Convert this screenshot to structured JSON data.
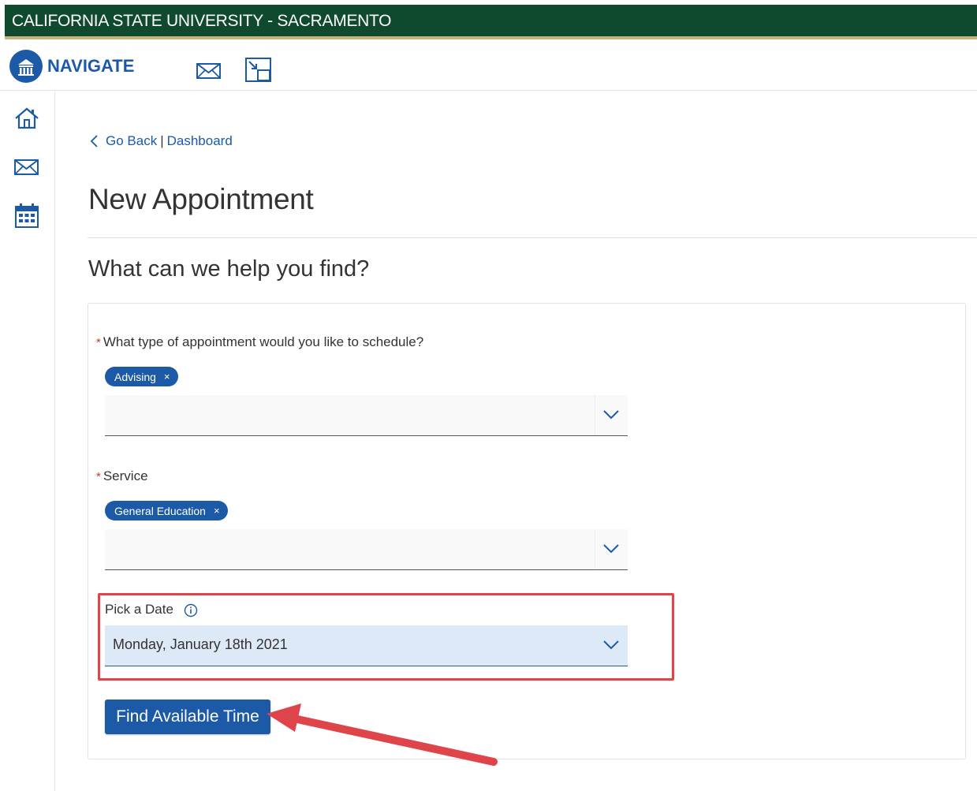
{
  "app": {
    "university_name": "CALIFORNIA STATE UNIVERSITY - SACRAMENTO",
    "logo_text": "NAVIGATE"
  },
  "colors": {
    "header_green": "#0f4a2f",
    "header_accent_gold": "#c8b37a",
    "primary_blue": "#1c5aa8",
    "annotation_red": "#e0444b",
    "date_field_bg": "#dde9f7"
  },
  "navbar": {
    "icons": [
      "university-logo-icon",
      "mail-icon",
      "external-link-icon"
    ]
  },
  "sidebar": {
    "icons": [
      "home-icon",
      "mail-icon",
      "calendar-icon"
    ]
  },
  "breadcrumb": {
    "back_label": "Go Back",
    "separator": "|",
    "dashboard_label": "Dashboard"
  },
  "page": {
    "title": "New Appointment",
    "section_title": "What can we help you find?"
  },
  "form": {
    "appointment_type": {
      "required_marker": "*",
      "label": "What type of appointment would you like to schedule?",
      "selected_chip": "Advising",
      "chip_remove": "×"
    },
    "service": {
      "required_marker": "*",
      "label": "Service",
      "selected_chip": "General Education",
      "chip_remove": "×"
    },
    "date": {
      "label": "Pick a Date",
      "value": "Monday, January 18th 2021"
    },
    "submit_label": "Find Available Time"
  }
}
